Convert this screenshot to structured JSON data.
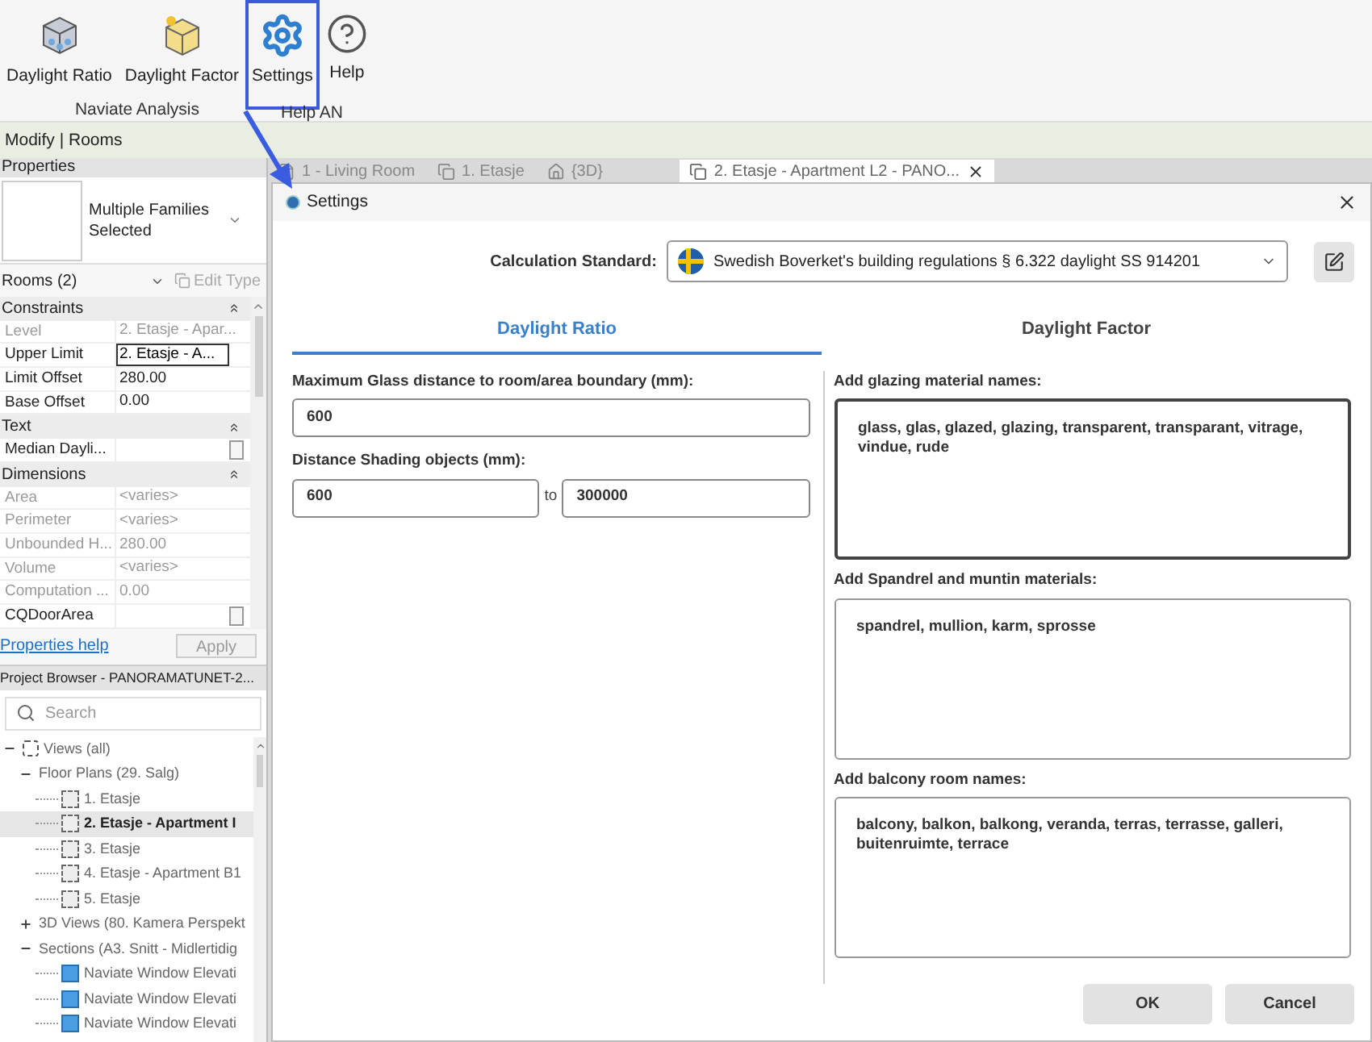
{
  "ribbon": {
    "buttons": [
      {
        "label": "Daylight Ratio",
        "kind": "ratio",
        "highlighted": false
      },
      {
        "label": "Daylight Factor",
        "kind": "factor",
        "highlighted": false
      },
      {
        "label": "Settings",
        "kind": "settings",
        "highlighted": true
      },
      {
        "label": "Help",
        "kind": "help",
        "highlighted": false
      }
    ],
    "groups": [
      "Naviate Analysis",
      "Help AN"
    ]
  },
  "context_bar": {
    "title": "Modify | Rooms"
  },
  "properties": {
    "title": "Properties",
    "type_name": "Multiple Families Selected",
    "filter": "Rooms (2)",
    "edit_type": {
      "label": "Edit Type",
      "disabled": true
    },
    "rows": [
      {
        "kind": "header",
        "label": "Constraints"
      },
      {
        "kind": "field",
        "label": "Level",
        "value": "2. Etasje - Apar...",
        "disabled": true
      },
      {
        "kind": "input",
        "label": "Upper Limit",
        "value": "2. Etasje - A...",
        "disabled": false
      },
      {
        "kind": "field",
        "label": "Limit Offset",
        "value": "280.00",
        "disabled": false
      },
      {
        "kind": "field",
        "label": "Base Offset",
        "value": "0.00",
        "disabled": false
      },
      {
        "kind": "header",
        "label": "Text"
      },
      {
        "kind": "check",
        "label": "Median Dayli...",
        "disabled": false
      },
      {
        "kind": "header",
        "label": "Dimensions"
      },
      {
        "kind": "field",
        "label": "Area",
        "value": "<varies>",
        "disabled": true
      },
      {
        "kind": "field",
        "label": "Perimeter",
        "value": "<varies>",
        "disabled": true
      },
      {
        "kind": "field",
        "label": "Unbounded H...",
        "value": "280.00",
        "disabled": true
      },
      {
        "kind": "field",
        "label": "Volume",
        "value": "<varies>",
        "disabled": true
      },
      {
        "kind": "field",
        "label": "Computation ...",
        "value": "0.00",
        "disabled": true
      },
      {
        "kind": "check",
        "label": "CQDoorArea",
        "disabled": false
      }
    ],
    "help_link": "Properties help",
    "apply": {
      "label": "Apply",
      "disabled": true
    }
  },
  "project_browser": {
    "title": "Project Browser - PANORAMATUNET-2...",
    "search": {
      "placeholder": "Search"
    },
    "tree": [
      {
        "label": "Views (all)",
        "kind": "root",
        "expanded": true,
        "selected": false,
        "children": [
          {
            "label": "Floor Plans (29. Salg)",
            "expanded": true,
            "selected": false,
            "children": [
              {
                "label": "1. Etasje",
                "kind": "plan",
                "selected": false
              },
              {
                "label": "2. Etasje - Apartment I",
                "kind": "plan",
                "selected": true
              },
              {
                "label": "3. Etasje",
                "kind": "plan",
                "selected": false
              },
              {
                "label": "4. Etasje - Apartment B1",
                "kind": "plan",
                "selected": false
              },
              {
                "label": "5. Etasje",
                "kind": "plan",
                "selected": false
              }
            ]
          },
          {
            "label": "3D Views (80. Kamera Perspekt",
            "expanded": false,
            "selected": false
          },
          {
            "label": "Sections (A3. Snitt - Midlertidig",
            "expanded": true,
            "selected": false,
            "children": [
              {
                "label": "Naviate Window Elevati",
                "kind": "section",
                "selected": false
              },
              {
                "label": "Naviate Window Elevati",
                "kind": "section",
                "selected": false
              },
              {
                "label": "Naviate Window Elevati",
                "kind": "section",
                "selected": false
              }
            ]
          }
        ]
      }
    ]
  },
  "view_tabs": [
    {
      "label": "1 - Living Room",
      "kind": "sheet",
      "selected": false
    },
    {
      "label": "1. Etasje",
      "kind": "plan",
      "selected": false
    },
    {
      "label": "{3D}",
      "kind": "model",
      "selected": false
    },
    {
      "label": "2. Etasje - Apartment L2 - PANO...",
      "kind": "plan",
      "selected": true
    }
  ],
  "dialog": {
    "title": "Settings",
    "standard": {
      "label": "Calculation Standard:",
      "value": "Swedish Boverket's building regulations § 6.322 daylight SS 914201"
    },
    "tabs": [
      {
        "label": "Daylight Ratio",
        "selected": true
      },
      {
        "label": "Daylight Factor",
        "selected": false
      }
    ],
    "glass_distance": {
      "label": "Maximum Glass distance to room/area boundary (mm):",
      "value": "600"
    },
    "shading": {
      "label": "Distance Shading objects (mm):",
      "from": "600",
      "separator": "to",
      "to": "300000"
    },
    "lists": [
      {
        "label": "Add glazing material names:",
        "value": "glass, glas, glazed, glazing, transparent, transparant, vitrage, vindue, rude",
        "focused": true
      },
      {
        "label": "Add Spandrel and muntin materials:",
        "value": "spandrel, mullion, karm, sprosse",
        "focused": false
      },
      {
        "label": "Add balcony room names:",
        "value": "balcony, balkon, balkong, veranda, terras, terrasse, galleri, buitenruimte, terrace",
        "focused": false
      }
    ],
    "buttons": [
      "OK",
      "Cancel"
    ]
  }
}
